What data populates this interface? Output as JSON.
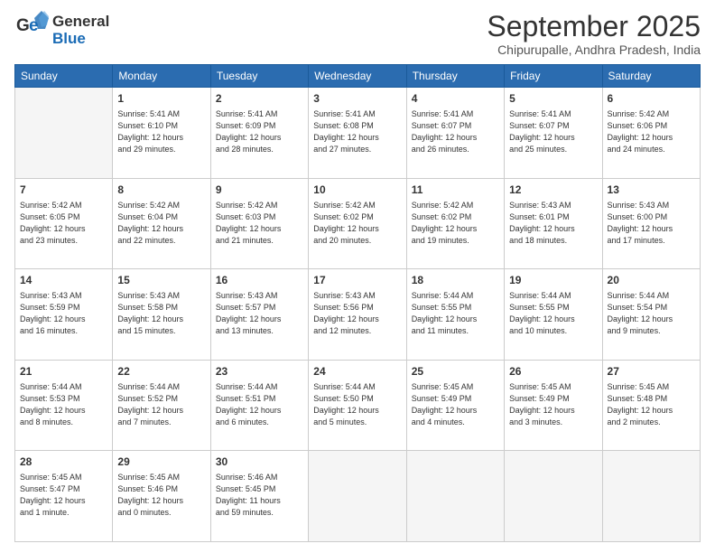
{
  "header": {
    "logo_general": "General",
    "logo_blue": "Blue",
    "month_title": "September 2025",
    "subtitle": "Chipurupalle, Andhra Pradesh, India"
  },
  "days_of_week": [
    "Sunday",
    "Monday",
    "Tuesday",
    "Wednesday",
    "Thursday",
    "Friday",
    "Saturday"
  ],
  "weeks": [
    [
      {
        "num": "",
        "info": ""
      },
      {
        "num": "1",
        "info": "Sunrise: 5:41 AM\nSunset: 6:10 PM\nDaylight: 12 hours\nand 29 minutes."
      },
      {
        "num": "2",
        "info": "Sunrise: 5:41 AM\nSunset: 6:09 PM\nDaylight: 12 hours\nand 28 minutes."
      },
      {
        "num": "3",
        "info": "Sunrise: 5:41 AM\nSunset: 6:08 PM\nDaylight: 12 hours\nand 27 minutes."
      },
      {
        "num": "4",
        "info": "Sunrise: 5:41 AM\nSunset: 6:07 PM\nDaylight: 12 hours\nand 26 minutes."
      },
      {
        "num": "5",
        "info": "Sunrise: 5:41 AM\nSunset: 6:07 PM\nDaylight: 12 hours\nand 25 minutes."
      },
      {
        "num": "6",
        "info": "Sunrise: 5:42 AM\nSunset: 6:06 PM\nDaylight: 12 hours\nand 24 minutes."
      }
    ],
    [
      {
        "num": "7",
        "info": "Sunrise: 5:42 AM\nSunset: 6:05 PM\nDaylight: 12 hours\nand 23 minutes."
      },
      {
        "num": "8",
        "info": "Sunrise: 5:42 AM\nSunset: 6:04 PM\nDaylight: 12 hours\nand 22 minutes."
      },
      {
        "num": "9",
        "info": "Sunrise: 5:42 AM\nSunset: 6:03 PM\nDaylight: 12 hours\nand 21 minutes."
      },
      {
        "num": "10",
        "info": "Sunrise: 5:42 AM\nSunset: 6:02 PM\nDaylight: 12 hours\nand 20 minutes."
      },
      {
        "num": "11",
        "info": "Sunrise: 5:42 AM\nSunset: 6:02 PM\nDaylight: 12 hours\nand 19 minutes."
      },
      {
        "num": "12",
        "info": "Sunrise: 5:43 AM\nSunset: 6:01 PM\nDaylight: 12 hours\nand 18 minutes."
      },
      {
        "num": "13",
        "info": "Sunrise: 5:43 AM\nSunset: 6:00 PM\nDaylight: 12 hours\nand 17 minutes."
      }
    ],
    [
      {
        "num": "14",
        "info": "Sunrise: 5:43 AM\nSunset: 5:59 PM\nDaylight: 12 hours\nand 16 minutes."
      },
      {
        "num": "15",
        "info": "Sunrise: 5:43 AM\nSunset: 5:58 PM\nDaylight: 12 hours\nand 15 minutes."
      },
      {
        "num": "16",
        "info": "Sunrise: 5:43 AM\nSunset: 5:57 PM\nDaylight: 12 hours\nand 13 minutes."
      },
      {
        "num": "17",
        "info": "Sunrise: 5:43 AM\nSunset: 5:56 PM\nDaylight: 12 hours\nand 12 minutes."
      },
      {
        "num": "18",
        "info": "Sunrise: 5:44 AM\nSunset: 5:55 PM\nDaylight: 12 hours\nand 11 minutes."
      },
      {
        "num": "19",
        "info": "Sunrise: 5:44 AM\nSunset: 5:55 PM\nDaylight: 12 hours\nand 10 minutes."
      },
      {
        "num": "20",
        "info": "Sunrise: 5:44 AM\nSunset: 5:54 PM\nDaylight: 12 hours\nand 9 minutes."
      }
    ],
    [
      {
        "num": "21",
        "info": "Sunrise: 5:44 AM\nSunset: 5:53 PM\nDaylight: 12 hours\nand 8 minutes."
      },
      {
        "num": "22",
        "info": "Sunrise: 5:44 AM\nSunset: 5:52 PM\nDaylight: 12 hours\nand 7 minutes."
      },
      {
        "num": "23",
        "info": "Sunrise: 5:44 AM\nSunset: 5:51 PM\nDaylight: 12 hours\nand 6 minutes."
      },
      {
        "num": "24",
        "info": "Sunrise: 5:44 AM\nSunset: 5:50 PM\nDaylight: 12 hours\nand 5 minutes."
      },
      {
        "num": "25",
        "info": "Sunrise: 5:45 AM\nSunset: 5:49 PM\nDaylight: 12 hours\nand 4 minutes."
      },
      {
        "num": "26",
        "info": "Sunrise: 5:45 AM\nSunset: 5:49 PM\nDaylight: 12 hours\nand 3 minutes."
      },
      {
        "num": "27",
        "info": "Sunrise: 5:45 AM\nSunset: 5:48 PM\nDaylight: 12 hours\nand 2 minutes."
      }
    ],
    [
      {
        "num": "28",
        "info": "Sunrise: 5:45 AM\nSunset: 5:47 PM\nDaylight: 12 hours\nand 1 minute."
      },
      {
        "num": "29",
        "info": "Sunrise: 5:45 AM\nSunset: 5:46 PM\nDaylight: 12 hours\nand 0 minutes."
      },
      {
        "num": "30",
        "info": "Sunrise: 5:46 AM\nSunset: 5:45 PM\nDaylight: 11 hours\nand 59 minutes."
      },
      {
        "num": "",
        "info": ""
      },
      {
        "num": "",
        "info": ""
      },
      {
        "num": "",
        "info": ""
      },
      {
        "num": "",
        "info": ""
      }
    ]
  ]
}
